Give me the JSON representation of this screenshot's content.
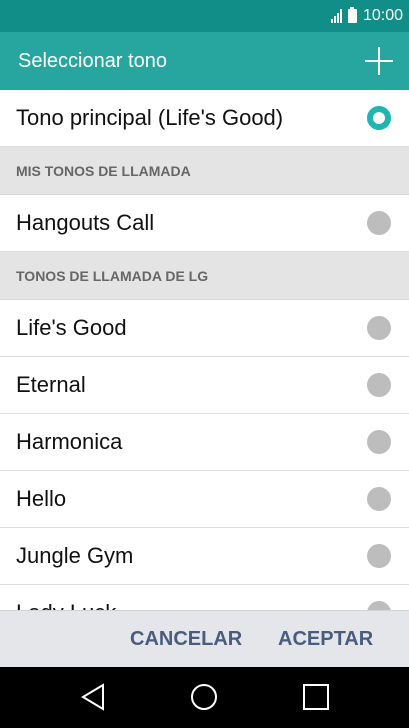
{
  "status_bar": {
    "time": "10:00"
  },
  "header": {
    "title": "Seleccionar tono",
    "add_icon": "plus-icon"
  },
  "list": {
    "current": {
      "label": "Tono principal (Life's Good)",
      "selected": true
    },
    "sections": [
      {
        "title": "MIS TONOS DE LLAMADA",
        "items": [
          "Hangouts Call"
        ]
      },
      {
        "title": "TONOS DE LLAMADA DE LG",
        "items": [
          "Life's Good",
          "Eternal",
          "Harmonica",
          "Hello",
          "Jungle Gym",
          "Lady Luck"
        ]
      }
    ]
  },
  "actions": {
    "cancel": "CANCELAR",
    "accept": "ACEPTAR"
  },
  "colors": {
    "status_bar": "#128e89",
    "header": "#27a6a0",
    "accent": "#1fb5b2",
    "action_text": "#4a5d80"
  },
  "nav": {
    "back_icon": "back-triangle-icon",
    "home_icon": "home-circle-icon",
    "recent_icon": "recent-square-icon"
  }
}
